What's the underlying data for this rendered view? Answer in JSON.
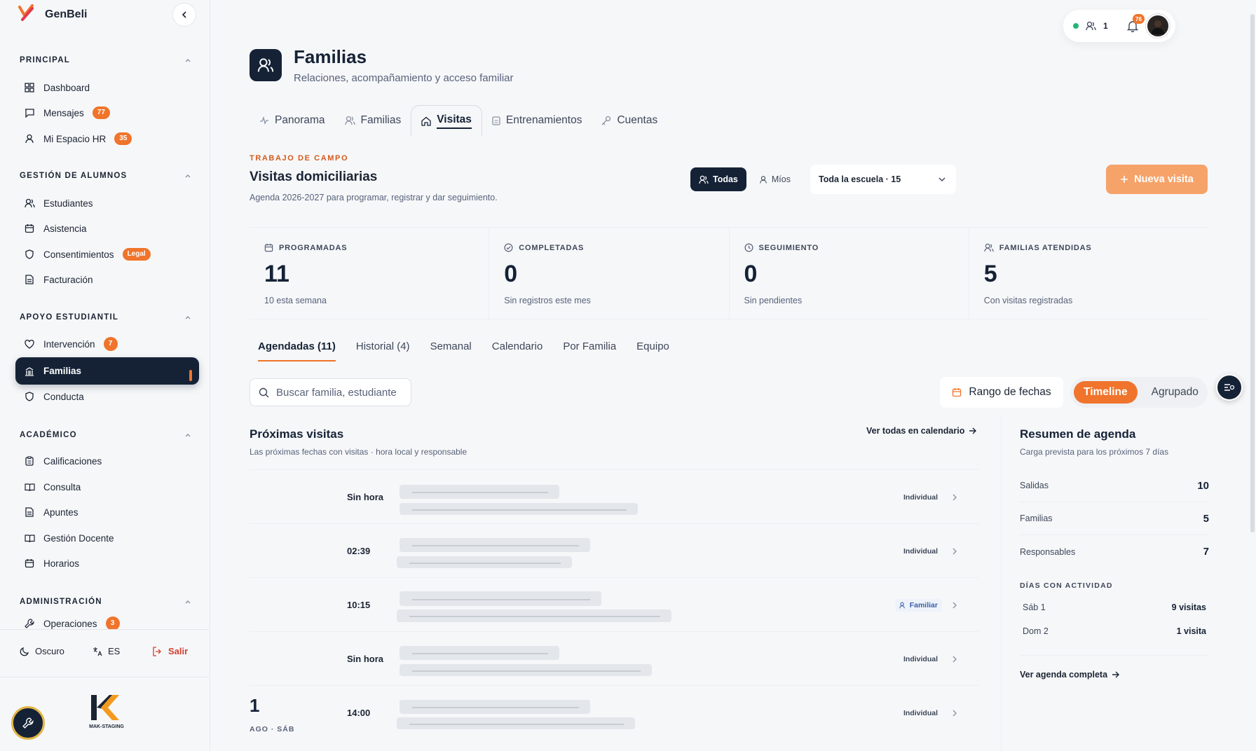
{
  "brand": {
    "name": "GenBeli",
    "logo_text": "MAK-STAGING"
  },
  "sidebar": {
    "sections": [
      {
        "title": "PRINCIPAL",
        "items": [
          {
            "label": "Dashboard",
            "icon": "grid-icon"
          },
          {
            "label": "Mensajes",
            "icon": "message-icon",
            "badge": "77"
          },
          {
            "label": "Mi Espacio HR",
            "icon": "user-icon",
            "badge": "35"
          }
        ]
      },
      {
        "title": "GESTIÓN DE ALUMNOS",
        "items": [
          {
            "label": "Estudiantes",
            "icon": "users-icon"
          },
          {
            "label": "Asistencia",
            "icon": "calendar-icon"
          },
          {
            "label": "Consentimientos",
            "icon": "shield-icon",
            "badge": "Legal"
          },
          {
            "label": "Facturación",
            "icon": "file-icon"
          }
        ]
      },
      {
        "title": "APOYO ESTUDIANTIL",
        "items": [
          {
            "label": "Intervención",
            "icon": "heart-icon",
            "badge": "7"
          },
          {
            "label": "Familias",
            "icon": "building-icon",
            "active": true
          },
          {
            "label": "Conducta",
            "icon": "shield-icon"
          }
        ]
      },
      {
        "title": "ACADÉMICO",
        "items": [
          {
            "label": "Calificaciones",
            "icon": "clipboard-icon"
          },
          {
            "label": "Consulta",
            "icon": "book-icon"
          },
          {
            "label": "Apuntes",
            "icon": "file-icon"
          },
          {
            "label": "Gestión Docente",
            "icon": "book-icon"
          },
          {
            "label": "Horarios",
            "icon": "calendar-icon"
          }
        ]
      },
      {
        "title": "ADMINISTRACIÓN",
        "items": [
          {
            "label": "Operaciones",
            "icon": "wrench-icon",
            "badge": "3"
          }
        ]
      }
    ],
    "footer": {
      "theme": "Oscuro",
      "lang": "ES",
      "logout": "Salir"
    }
  },
  "topbar": {
    "online_count": "1",
    "notifications": "76"
  },
  "header": {
    "title": "Familias",
    "subtitle": "Relaciones, acompañamiento y acceso familiar"
  },
  "tabs": [
    {
      "label": "Panorama",
      "icon": "pulse-icon"
    },
    {
      "label": "Familias",
      "icon": "users-icon"
    },
    {
      "label": "Visitas",
      "icon": "home-icon",
      "active": true
    },
    {
      "label": "Entrenamientos",
      "icon": "clipboard-icon"
    },
    {
      "label": "Cuentas",
      "icon": "key-icon"
    }
  ],
  "section": {
    "eyebrow": "TRABAJO DE CAMPO",
    "title": "Visitas domiciliarias",
    "subtitle": "Agenda 2026-2027 para programar, registrar y dar seguimiento.",
    "filter_all": "Todas",
    "filter_mine": "Míos",
    "scope_select": "Toda la escuela · 15",
    "new_button": "Nueva visita"
  },
  "stats": [
    {
      "label": "PROGRAMADAS",
      "value": "11",
      "note": "10 esta semana",
      "icon": "calendar-icon"
    },
    {
      "label": "COMPLETADAS",
      "value": "0",
      "note": "Sin registros este mes",
      "icon": "check-circle-icon"
    },
    {
      "label": "SEGUIMIENTO",
      "value": "0",
      "note": "Sin pendientes",
      "icon": "clock-icon"
    },
    {
      "label": "FAMILIAS ATENDIDAS",
      "value": "5",
      "note": "Con visitas registradas",
      "icon": "users-icon"
    }
  ],
  "subtabs": [
    "Agendadas (11)",
    "Historial (4)",
    "Semanal",
    "Calendario",
    "Por Familia",
    "Equipo"
  ],
  "toolbar": {
    "search_placeholder": "Buscar familia, estudiante",
    "date_range": "Rango de fechas",
    "view_timeline": "Timeline",
    "view_grouped": "Agrupado"
  },
  "upcoming": {
    "title": "Próximas visitas",
    "subtitle": "Las próximas fechas con visitas · hora local y responsable",
    "link": "Ver todas en calendario",
    "day_number": "1",
    "day_label": "AGO · SÁB",
    "visits": [
      {
        "time": "Sin hora",
        "type": "Individual"
      },
      {
        "time": "02:39",
        "type": "Individual"
      },
      {
        "time": "10:15",
        "type": "Familiar"
      },
      {
        "time": "Sin hora",
        "type": "Individual"
      },
      {
        "time": "14:00",
        "type": "Individual"
      }
    ]
  },
  "agenda": {
    "title": "Resumen de agenda",
    "subtitle": "Carga prevista para los próximos 7 días",
    "rows": [
      {
        "label": "Salidas",
        "value": "10"
      },
      {
        "label": "Familias",
        "value": "5"
      },
      {
        "label": "Responsables",
        "value": "7"
      }
    ],
    "days_title": "DÍAS CON ACTIVIDAD",
    "days": [
      {
        "label": "Sáb 1",
        "value": "9 visitas"
      },
      {
        "label": "Dom 2",
        "value": "1 visita"
      }
    ],
    "link": "Ver agenda completa"
  },
  "colors": {
    "navy": "#152236",
    "orange": "#f0742b",
    "accent_red": "#d55a1b"
  }
}
